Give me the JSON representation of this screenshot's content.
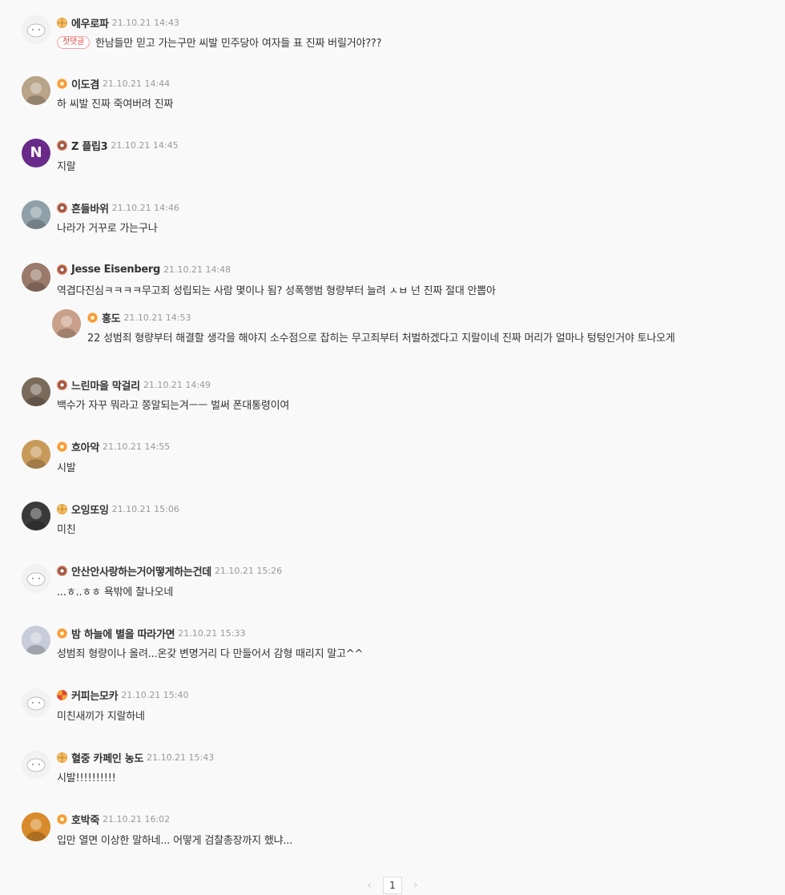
{
  "comments": [
    {
      "nick": "에우로파",
      "time": "21.10.21 14:43",
      "first_tag": "첫댓글",
      "text": "한남들만 믿고 가는구만 씨발 민주당아 여자들 표 진짜 버릴거야???",
      "badge": "waffle",
      "avatar": "sheep-avatar",
      "avatar_color": "#f2f2f2"
    },
    {
      "nick": "이도겸",
      "time": "21.10.21 14:44",
      "text": "하 씨발 진짜 죽여버려 진짜",
      "badge": "flower",
      "avatar": "person-photo-avatar",
      "avatar_color": "#b9a48a"
    },
    {
      "nick": "Z 플립3",
      "time": "21.10.21 14:45",
      "text": "지랄",
      "badge": "donut",
      "avatar": "letter-n-avatar",
      "avatar_color": "#6a2a8a",
      "avatar_letter": "N"
    },
    {
      "nick": "흔들바위",
      "time": "21.10.21 14:46",
      "text": "나라가 거꾸로 가는구나",
      "badge": "donut",
      "avatar": "animal-photo-avatar",
      "avatar_color": "#8fa0a8"
    },
    {
      "nick": "Jesse Eisenberg",
      "time": "21.10.21 14:48",
      "text": "역겹다진심ㅋㅋㅋㅋ무고죄 성립되는 사람 몇이나 됨? 성폭행범 형량부터 늘려 ㅅㅂ 넌 진짜 절대 안뽑아",
      "badge": "donut",
      "avatar": "person-photo-avatar",
      "avatar_color": "#9a7a6a"
    },
    {
      "nick": "홍도",
      "time": "21.10.21 14:53",
      "text": "22 성범죄 형량부터 해결할 생각을 해야지 소수점으로 잡히는 무고죄부터 처벌하겠다고 지랄이네 진짜 머리가 얼마나 텅텅인거야 토나오게",
      "badge": "flower",
      "avatar": "person-photo-avatar",
      "avatar_color": "#c9a08a",
      "reply": true
    },
    {
      "nick": "느린마을 막걸리",
      "time": "21.10.21 14:49",
      "text": "백수가 자꾸 뭐라고 쫑알되는겨ㅡㅡ 벌써 폰대통령이여",
      "badge": "donut",
      "avatar": "room-photo-avatar",
      "avatar_color": "#7a6a5a"
    },
    {
      "nick": "흐아악",
      "time": "21.10.21 14:55",
      "text": "시발",
      "badge": "flower",
      "avatar": "food-photo-avatar",
      "avatar_color": "#c89a5a"
    },
    {
      "nick": "오잉또잉",
      "time": "21.10.21 15:06",
      "text": "미친",
      "badge": "waffle",
      "avatar": "cat-photo-avatar",
      "avatar_color": "#3a3a3a"
    },
    {
      "nick": "안산안사랑하는거어떻게하는건데",
      "time": "21.10.21 15:26",
      "text": "...ㅎ..ㅎㅎ 욕밖에 찰나오네",
      "badge": "donut",
      "avatar": "sheep-avatar",
      "avatar_color": "#f2f2f2"
    },
    {
      "nick": "밤 하늘에 별을 따라가면",
      "time": "21.10.21 15:33",
      "text": "성범죄 형량이나 올려...온갖 변명거리 다 만들어서 감형 때리지 말고^^",
      "badge": "flower",
      "avatar": "anime-avatar",
      "avatar_color": "#c8ccd8"
    },
    {
      "nick": "커피는모카",
      "time": "21.10.21 15:40",
      "text": "미친새끼가 지랄하네",
      "badge": "pinwheel",
      "avatar": "sheep-avatar",
      "avatar_color": "#f2f2f2"
    },
    {
      "nick": "혈중 카페인 농도",
      "time": "21.10.21 15:43",
      "text": "시발!!!!!!!!!!",
      "badge": "waffle",
      "avatar": "sheep-avatar",
      "avatar_color": "#f2f2f2"
    },
    {
      "nick": "호박죽",
      "time": "21.10.21 16:02",
      "text": "입만 열면 이상한 말하네... 어떻게 검찰총장까지 했냐...",
      "badge": "flower",
      "avatar": "pumpkin-soup-avatar",
      "avatar_color": "#d98a2a"
    }
  ],
  "pager": {
    "prev": "‹",
    "current": "1",
    "next": "›"
  }
}
